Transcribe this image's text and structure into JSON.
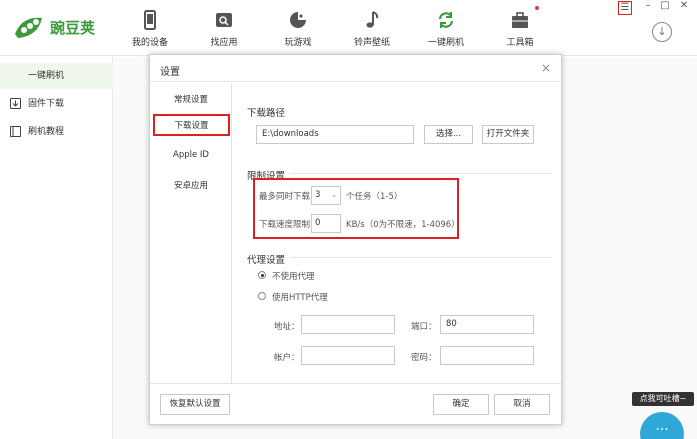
{
  "app": {
    "name": "豌豆荚"
  },
  "nav": [
    {
      "label": "我的设备",
      "icon": "phone-icon"
    },
    {
      "label": "找应用",
      "icon": "app-store-icon"
    },
    {
      "label": "玩游戏",
      "icon": "gamepad-icon"
    },
    {
      "label": "铃声壁纸",
      "icon": "music-note-icon"
    },
    {
      "label": "一键刷机",
      "icon": "refresh-icon",
      "active": true
    },
    {
      "label": "工具箱",
      "icon": "toolbox-icon"
    }
  ],
  "window_controls": {
    "menu": "☰",
    "minimize": "–",
    "maximize": "□",
    "close": "✕",
    "download": "↓"
  },
  "sidebar": {
    "items": [
      {
        "label": "一键刷机",
        "active": true
      },
      {
        "label": "固件下载",
        "icon": "download-icon"
      },
      {
        "label": "刷机教程",
        "icon": "book-icon"
      }
    ]
  },
  "dialog": {
    "title": "设置",
    "close": "×",
    "tabs": [
      {
        "label": "常规设置"
      },
      {
        "label": "下载设置",
        "active": true
      },
      {
        "label": "Apple ID"
      },
      {
        "label": "安卓应用"
      }
    ],
    "download_path": {
      "title": "下载路径",
      "value": "E:\\downloads",
      "choose_button": "选择...",
      "open_folder_button": "打开文件夹"
    },
    "limits": {
      "title": "限制设置",
      "max_tasks_label": "最多同时下载",
      "max_tasks_value": "3",
      "max_tasks_unit": "个任务（1-5）",
      "speed_label": "下载速度限制",
      "speed_value": "0",
      "speed_unit": "KB/s（0为不限速，1-4096）"
    },
    "proxy": {
      "title": "代理设置",
      "no_proxy": "不使用代理",
      "http_proxy": "使用HTTP代理",
      "address_label": "地址：",
      "address_value": "",
      "port_label": "端口：",
      "port_value": "80",
      "account_label": "帐户：",
      "account_value": "",
      "password_label": "密码：",
      "password_value": ""
    },
    "footer": {
      "restore_button": "恢复默认设置",
      "ok_button": "确定",
      "cancel_button": "取消"
    }
  },
  "help": {
    "tooltip": "点我可吐槽~",
    "bubble": "···"
  },
  "colors": {
    "brand_green": "#3c9a3c",
    "highlight_red": "#e02020",
    "help_blue": "#2fa8d8"
  }
}
